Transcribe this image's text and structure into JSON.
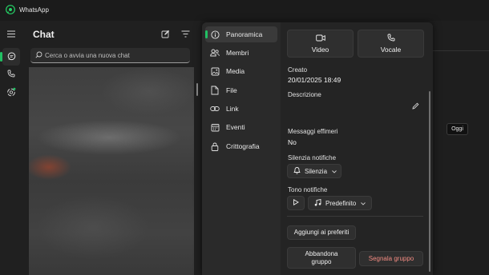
{
  "titlebar": {
    "app_title": "WhatsApp"
  },
  "sidebar_rail": {
    "items": [
      {
        "name": "chats",
        "icon": "chat-bubble-icon",
        "active": true
      },
      {
        "name": "calls",
        "icon": "phone-icon",
        "active": false
      },
      {
        "name": "status",
        "icon": "status-ring-icon",
        "active": false
      }
    ]
  },
  "chat_list": {
    "title": "Chat",
    "new_chat_icon": "compose-icon",
    "filter_icon": "filter-icon",
    "search_placeholder": "Cerca o avvia una nuova chat"
  },
  "group_info": {
    "nav": [
      {
        "label": "Panoramica",
        "icon": "info-icon",
        "active": true
      },
      {
        "label": "Membri",
        "icon": "members-icon",
        "active": false
      },
      {
        "label": "Media",
        "icon": "image-icon",
        "active": false
      },
      {
        "label": "File",
        "icon": "file-icon",
        "active": false
      },
      {
        "label": "Link",
        "icon": "link-icon",
        "active": false
      },
      {
        "label": "Eventi",
        "icon": "calendar-icon",
        "active": false
      },
      {
        "label": "Crittografia",
        "icon": "lock-icon",
        "active": false
      }
    ],
    "overview": {
      "video_label": "Video",
      "voice_label": "Vocale",
      "created_label": "Creato",
      "created_value": "20/01/2025 18:49",
      "description_label": "Descrizione",
      "ephemeral_label": "Messaggi effimeri",
      "ephemeral_value": "No",
      "mute_label": "Silenzia notifiche",
      "mute_value": "Silenzia",
      "tone_label": "Tono notifiche",
      "tone_value": "Predefinito",
      "favorites_label": "Aggiungi ai preferiti",
      "leave_label": "Abbandona gruppo",
      "report_label": "Segnala gruppo"
    }
  },
  "tooltip": {
    "text": "Oggi"
  },
  "colors": {
    "accent": "#21c063",
    "danger": "#f28b82",
    "panel_bg": "#272727",
    "app_bg": "#1d1d1d"
  }
}
